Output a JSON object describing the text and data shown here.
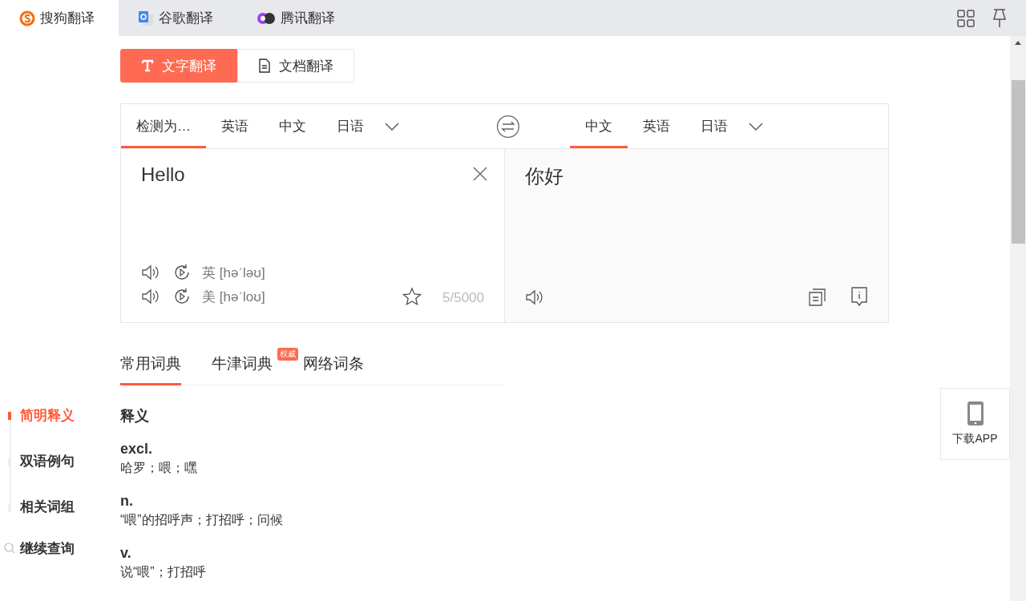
{
  "browser_tabs": [
    {
      "label": "搜狗翻译",
      "selected": true,
      "kind": "sogou"
    },
    {
      "label": "谷歌翻译",
      "selected": false,
      "kind": "google"
    },
    {
      "label": "腾讯翻译",
      "selected": false,
      "kind": "tencent"
    }
  ],
  "mode_tabs": [
    {
      "label": "文字翻译",
      "selected": true,
      "kind": "text"
    },
    {
      "label": "文档翻译",
      "selected": false,
      "kind": "document"
    }
  ],
  "source_langs": [
    {
      "label": "检测为…",
      "selected": true
    },
    {
      "label": "英语",
      "selected": false
    },
    {
      "label": "中文",
      "selected": false
    },
    {
      "label": "日语",
      "selected": false
    }
  ],
  "target_langs": [
    {
      "label": "中文",
      "selected": true
    },
    {
      "label": "英语",
      "selected": false
    },
    {
      "label": "日语",
      "selected": false
    }
  ],
  "source_text": "Hello",
  "phonetics": [
    {
      "region": "英",
      "ipa": "[həˈləʊ]"
    },
    {
      "region": "美",
      "ipa": "[həˈloʊ]"
    }
  ],
  "char_count": "5/5000",
  "translation": "你好",
  "dict_tabs": [
    {
      "label": "常用词典",
      "selected": true
    },
    {
      "label": "牛津词典",
      "selected": false,
      "badge": "权威"
    },
    {
      "label": "网络词条",
      "selected": false
    }
  ],
  "side_nav": [
    {
      "label": "简明释义",
      "selected": true,
      "kind": "section"
    },
    {
      "label": "双语例句",
      "selected": false,
      "kind": "section"
    },
    {
      "label": "相关词组",
      "selected": false,
      "kind": "section"
    },
    {
      "label": "继续查询",
      "selected": false,
      "kind": "search"
    }
  ],
  "definitions": {
    "heading": "释义",
    "entries": [
      {
        "pos": "excl.",
        "meaning": "哈罗；喂；嘿"
      },
      {
        "pos": "n.",
        "meaning": "“喂”的招呼声；打招呼；问候"
      },
      {
        "pos": "v.",
        "meaning": "说“喂”；打招呼"
      }
    ]
  },
  "download": {
    "label": "下载APP"
  }
}
